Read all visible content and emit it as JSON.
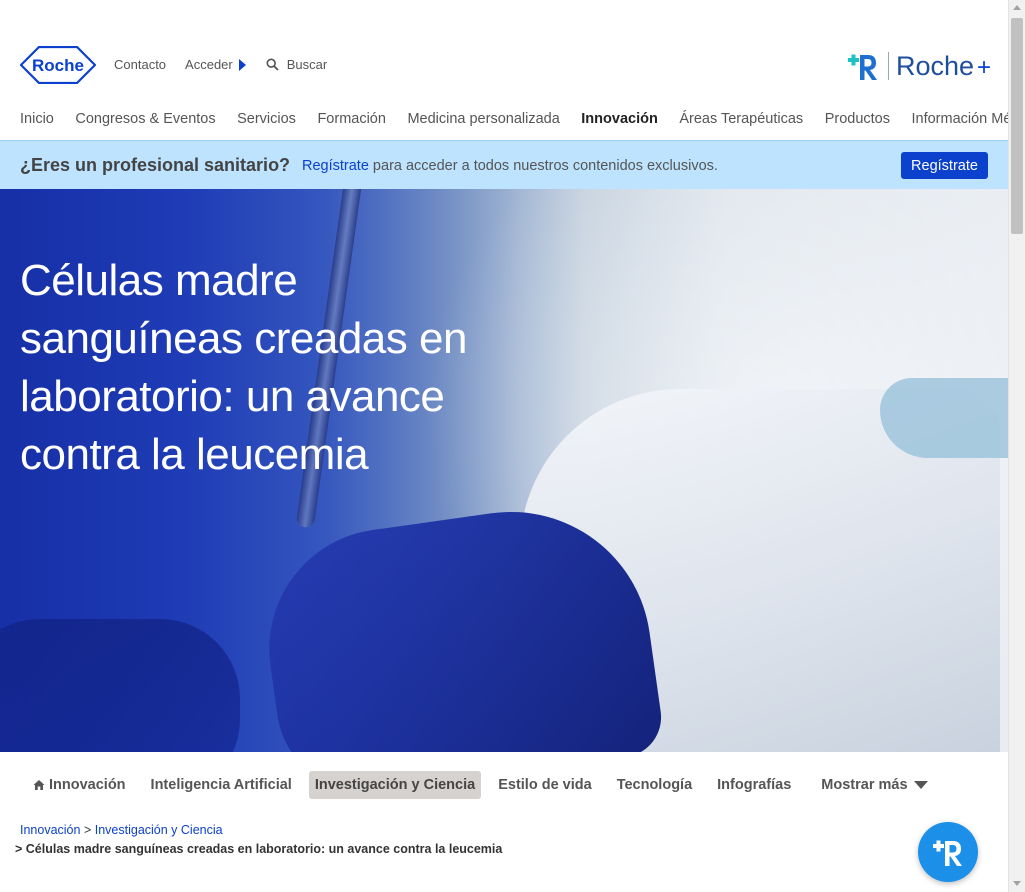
{
  "brand": {
    "logo_text": "Roche",
    "accent": "#0b41cd",
    "banner_bg": "#bde3ff",
    "fab_color": "#1c8fe8"
  },
  "top_links": {
    "contact": "Contacto",
    "login": "Acceder",
    "search": "Buscar"
  },
  "roche_plus": {
    "label": "Roche",
    "plus": "+"
  },
  "main_nav": [
    "Inicio",
    "Congresos & Eventos",
    "Servicios",
    "Formación",
    "Medicina personalizada",
    "Innovación",
    "Áreas Terapéuticas",
    "Productos",
    "Información Médica"
  ],
  "main_nav_active": "Innovación",
  "promo": {
    "question": "¿Eres un profesional sanitario?",
    "link": "Regístrate",
    "text": " para acceder a todos nuestros contenidos exclusivos.",
    "button": "Regístrate"
  },
  "hero": {
    "title": "Células madre sanguíneas creadas en laboratorio: un avance contra la leucemia"
  },
  "sub_nav": [
    "Innovación",
    "Inteligencia Artificial",
    "Investigación y Ciencia",
    "Estilo de vida",
    "Tecnología",
    "Infografías"
  ],
  "sub_nav_more": "Mostrar más",
  "breadcrumb": {
    "items": [
      "Innovación",
      "Investigación y Ciencia"
    ],
    "separator": ">",
    "current": "> Células madre sanguíneas creadas en laboratorio: un avance contra la leucemia"
  }
}
